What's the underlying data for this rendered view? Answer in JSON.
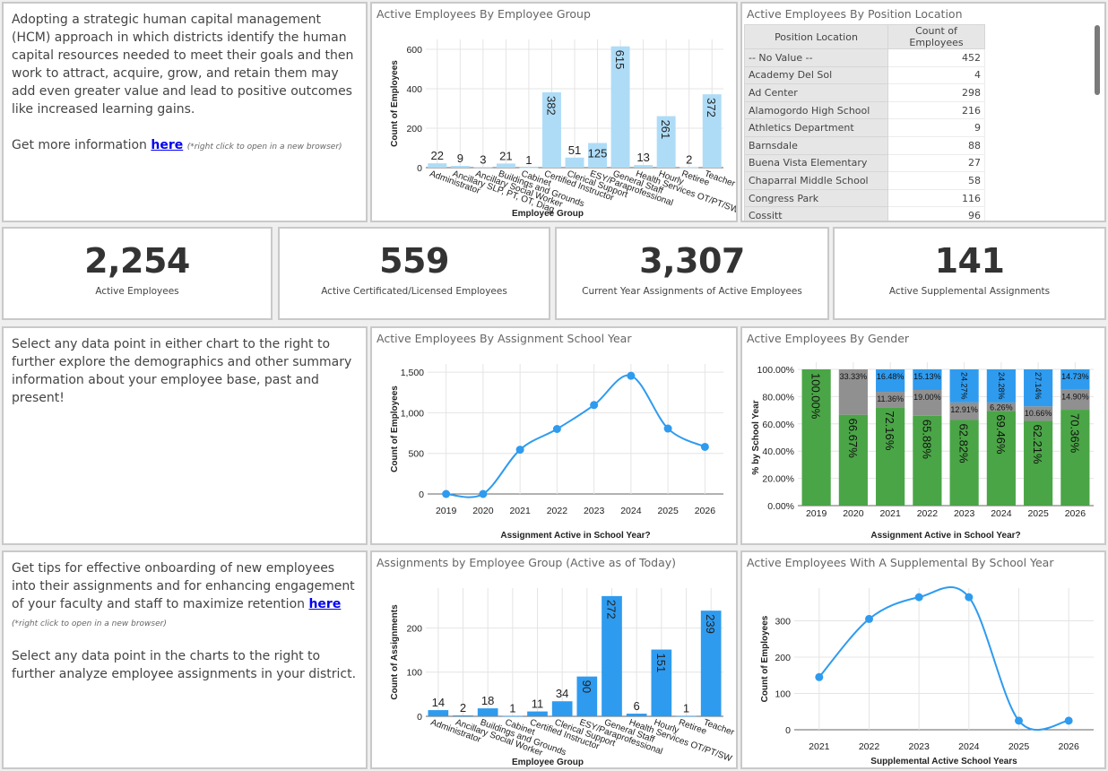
{
  "info_panels": {
    "hcm": {
      "text": "Adopting a strategic human capital management (HCM) approach in which districts identify the human capital resources needed to meet their goals and then work to attract, acquire, grow, and retain them may add even greater value and lead to positive outcomes like increased learning gains.",
      "link_prefix": "Get more information ",
      "link_label": "here",
      "note": "(*right click to open in a new browser)"
    },
    "explore": {
      "text": "Select any data point in either chart to the right to further explore the demographics and other summary information about your employee base, past and present!"
    },
    "onboarding": {
      "text": "Get tips for effective onboarding of new employees into their assignments and for enhancing engagement of your faculty and staff to maximize retention ",
      "link_label": "here",
      "note": "(*right click to open in a new browser)",
      "text2": "Select any data point in the charts to the right to further analyze employee assignments in your district."
    }
  },
  "kpis": [
    {
      "value": "2,254",
      "label": "Active Employees"
    },
    {
      "value": "559",
      "label": "Active Certificated/Licensed Employees"
    },
    {
      "value": "3,307",
      "label": "Current Year Assignments of Active Employees"
    },
    {
      "value": "141",
      "label": "Active Supplemental Assignments"
    }
  ],
  "location_table": {
    "title": "Active Employees By Position Location",
    "columns": [
      "Position Location",
      "Count of Employees"
    ],
    "rows": [
      [
        "-- No Value --",
        "452"
      ],
      [
        "Academy Del Sol",
        "4"
      ],
      [
        "Ad Center",
        "298"
      ],
      [
        "Alamogordo High School",
        "216"
      ],
      [
        "Athletics Department",
        "9"
      ],
      [
        "Barnsdale",
        "88"
      ],
      [
        "Buena Vista Elementary",
        "27"
      ],
      [
        "Chaparral Middle School",
        "58"
      ],
      [
        "Congress Park",
        "116"
      ],
      [
        "Cossitt",
        "96"
      ]
    ]
  },
  "colors": {
    "light_bar": "#aedcf7",
    "bar": "#2e9bef",
    "line": "#2e9bef",
    "green": "#4aa546",
    "gray": "#909090",
    "blue": "#2e9bef"
  },
  "chart_data": [
    {
      "id": "emp_group",
      "type": "bar",
      "title": "Active Employees By Employee Group",
      "xlabel": "Employee Group",
      "ylabel": "Count of Employees",
      "ylim": [
        0,
        650
      ],
      "yticks": [
        0,
        200,
        400,
        600
      ],
      "grid": true,
      "categories": [
        "Administrator",
        "Ancillary SLP, PT, OT, Diag",
        "Ancillary Social Worker",
        "Buildings and Grounds",
        "Cabinet",
        "Certified Instructor",
        "Clerical Support",
        "ESY/Paraprofessional",
        "General Staff",
        "Health Services OT/PT/SW",
        "Hourly",
        "Retiree",
        "Teacher"
      ],
      "values": [
        22,
        9,
        3,
        21,
        1,
        382,
        51,
        125,
        615,
        13,
        261,
        2,
        372
      ]
    },
    {
      "id": "school_year",
      "type": "line",
      "title": "Active Employees By Assignment School Year",
      "xlabel": "Assignment Active in School Year?",
      "ylabel": "Count of Employees",
      "ylim": [
        0,
        1600
      ],
      "yticks": [
        0,
        500,
        1000,
        1500
      ],
      "ytick_labels": [
        "0",
        "500",
        "1,000",
        "1,500"
      ],
      "grid": true,
      "x": [
        "2019",
        "2020",
        "2021",
        "2022",
        "2023",
        "2024",
        "2025",
        "2026"
      ],
      "values": [
        0,
        0,
        545,
        800,
        1095,
        1455,
        805,
        580
      ]
    },
    {
      "id": "gender",
      "type": "bar",
      "stacked": true,
      "title": "Active Employees By Gender",
      "xlabel": "Assignment Active in School Year?",
      "ylabel": "% by School Year",
      "ylim": [
        0,
        100
      ],
      "yticks": [
        0,
        20,
        40,
        60,
        80,
        100
      ],
      "ytick_labels": [
        "0.00%",
        "20.00%",
        "40.00%",
        "60.00%",
        "80.00%",
        "100.00%"
      ],
      "grid": true,
      "categories": [
        "2019",
        "2020",
        "2021",
        "2022",
        "2023",
        "2024",
        "2025",
        "2026"
      ],
      "series": [
        {
          "name": "green",
          "values": [
            100.0,
            66.67,
            72.16,
            65.88,
            62.82,
            69.46,
            62.21,
            70.36
          ]
        },
        {
          "name": "gray",
          "values": [
            0,
            33.33,
            11.36,
            19.0,
            12.91,
            6.26,
            10.66,
            14.9
          ]
        },
        {
          "name": "blue",
          "values": [
            0,
            0,
            16.48,
            15.13,
            24.27,
            24.28,
            27.14,
            14.73
          ]
        }
      ]
    },
    {
      "id": "assign_group",
      "type": "bar",
      "title": "Assignments by Employee Group (Active as of Today)",
      "xlabel": "Employee Group",
      "ylabel": "Count  of Assignments",
      "ylim": [
        0,
        290
      ],
      "yticks": [
        0,
        100,
        200
      ],
      "grid": true,
      "categories": [
        "Administrator",
        "Ancillary Social Worker",
        "Buildings and Grounds",
        "Cabinet",
        "Certified Instructor",
        "Clerical Support",
        "ESY/Paraprofessional",
        "General Staff",
        "Health Services OT/PT/SW",
        "Hourly",
        "Retiree",
        "Teacher"
      ],
      "values": [
        14,
        2,
        18,
        1,
        11,
        34,
        90,
        272,
        6,
        151,
        1,
        239
      ]
    },
    {
      "id": "supplemental",
      "type": "line",
      "title": "Active Employees With A Supplemental By School Year",
      "xlabel": "Supplemental Active School Years",
      "ylabel": "Count of Employees",
      "ylim": [
        0,
        390
      ],
      "yticks": [
        0,
        100,
        200,
        300
      ],
      "grid": true,
      "x": [
        "2021",
        "2022",
        "2023",
        "2024",
        "2025",
        "2026"
      ],
      "values": [
        145,
        305,
        365,
        365,
        25,
        25
      ]
    }
  ]
}
